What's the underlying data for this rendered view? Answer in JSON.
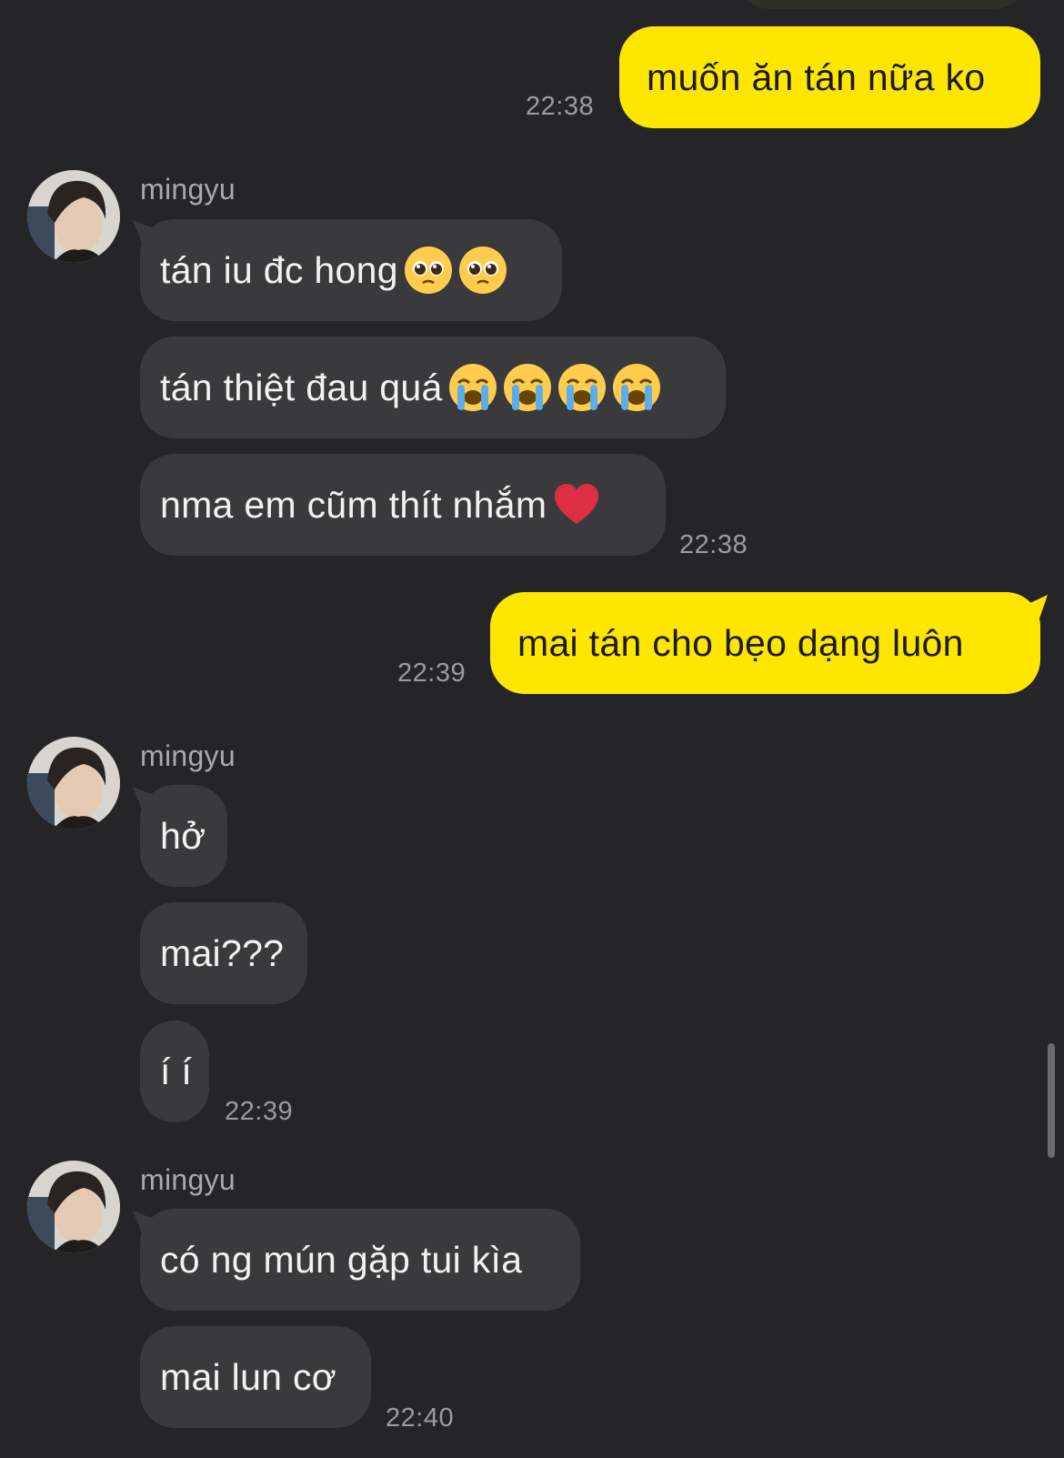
{
  "messages": [
    {
      "side": "out",
      "text": "muốn ăn tán nữa ko",
      "time": "22:38"
    },
    {
      "side": "in",
      "sender": "mingyu",
      "text": "tán iu đc hong",
      "emojis": [
        "pleading-face",
        "pleading-face"
      ]
    },
    {
      "side": "in",
      "text": "tán thiệt đau quá",
      "emojis": [
        "loudly-crying-face",
        "loudly-crying-face",
        "loudly-crying-face",
        "loudly-crying-face"
      ]
    },
    {
      "side": "in",
      "text": "nma em cũm thít nhắm",
      "emojis": [
        "red-heart"
      ],
      "time": "22:38"
    },
    {
      "side": "out",
      "text": "mai tán cho bẹo dạng luôn",
      "time": "22:39"
    },
    {
      "side": "in",
      "sender": "mingyu",
      "text": "hở"
    },
    {
      "side": "in",
      "text": "mai???"
    },
    {
      "side": "in",
      "text": "í í",
      "time": "22:39"
    },
    {
      "side": "in",
      "sender": "mingyu",
      "text": "có ng mún gặp tui kìa"
    },
    {
      "side": "in",
      "text": "mai lun cơ",
      "time": "22:40"
    }
  ],
  "colors": {
    "background": "#252527",
    "incoming_bubble": "#3a3a3c",
    "outgoing_bubble": "#ffe600",
    "timestamp": "#9b9b9d"
  }
}
